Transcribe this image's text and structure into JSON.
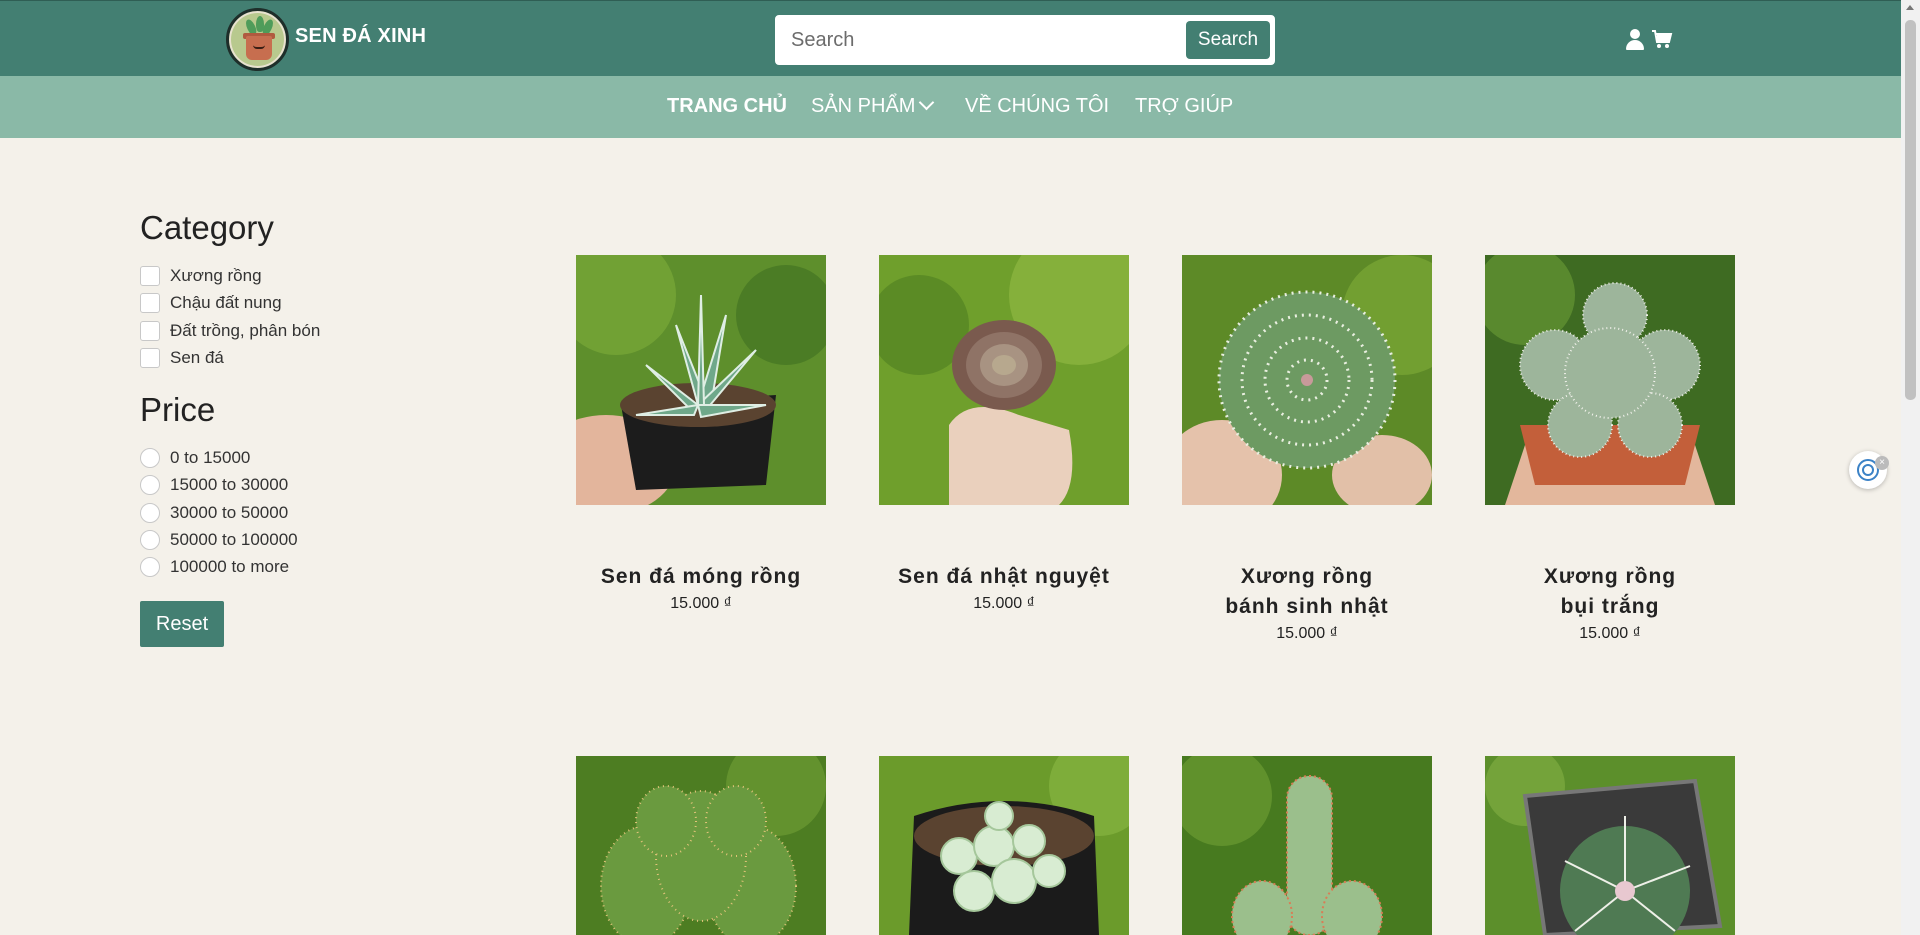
{
  "header": {
    "brand": "SEN ĐÁ XINH",
    "logo_icon": "cactus-pot-logo",
    "search_placeholder": "Search",
    "search_button": "Search",
    "icons": [
      "user-icon",
      "cart-icon"
    ],
    "colors": {
      "primary": "#437f72",
      "nav_bg": "#8ab9a7",
      "page_bg": "#f4f1ea"
    }
  },
  "nav": {
    "items": [
      {
        "label": "TRANG CHỦ",
        "active": true
      },
      {
        "label": "SẢN PHẨM",
        "dropdown": true
      },
      {
        "label": "VỀ CHÚNG TÔI"
      },
      {
        "label": "TRỢ GIÚP"
      }
    ]
  },
  "sidebar": {
    "category_title": "Category",
    "categories": [
      "Xương rồng",
      "Chậu đất nung",
      "Đất trồng, phân bón",
      "Sen đá"
    ],
    "price_title": "Price",
    "prices": [
      "0 to 15000",
      "15000 to 30000",
      "30000 to 50000",
      "50000 to 100000",
      "100000 to more"
    ],
    "reset_label": "Reset"
  },
  "products": [
    {
      "name": "Sen đá móng rồng",
      "price": "15.000 ₫"
    },
    {
      "name": "Sen đá nhật nguyệt",
      "price": "15.000 ₫"
    },
    {
      "name": "Xương rồng bánh sinh nhật",
      "price": "15.000 ₫"
    },
    {
      "name": "Xương rồng bụi trắng",
      "price": "15.000 ₫"
    },
    {
      "name": "",
      "price": ""
    },
    {
      "name": "",
      "price": ""
    },
    {
      "name": "",
      "price": ""
    },
    {
      "name": "",
      "price": ""
    }
  ]
}
